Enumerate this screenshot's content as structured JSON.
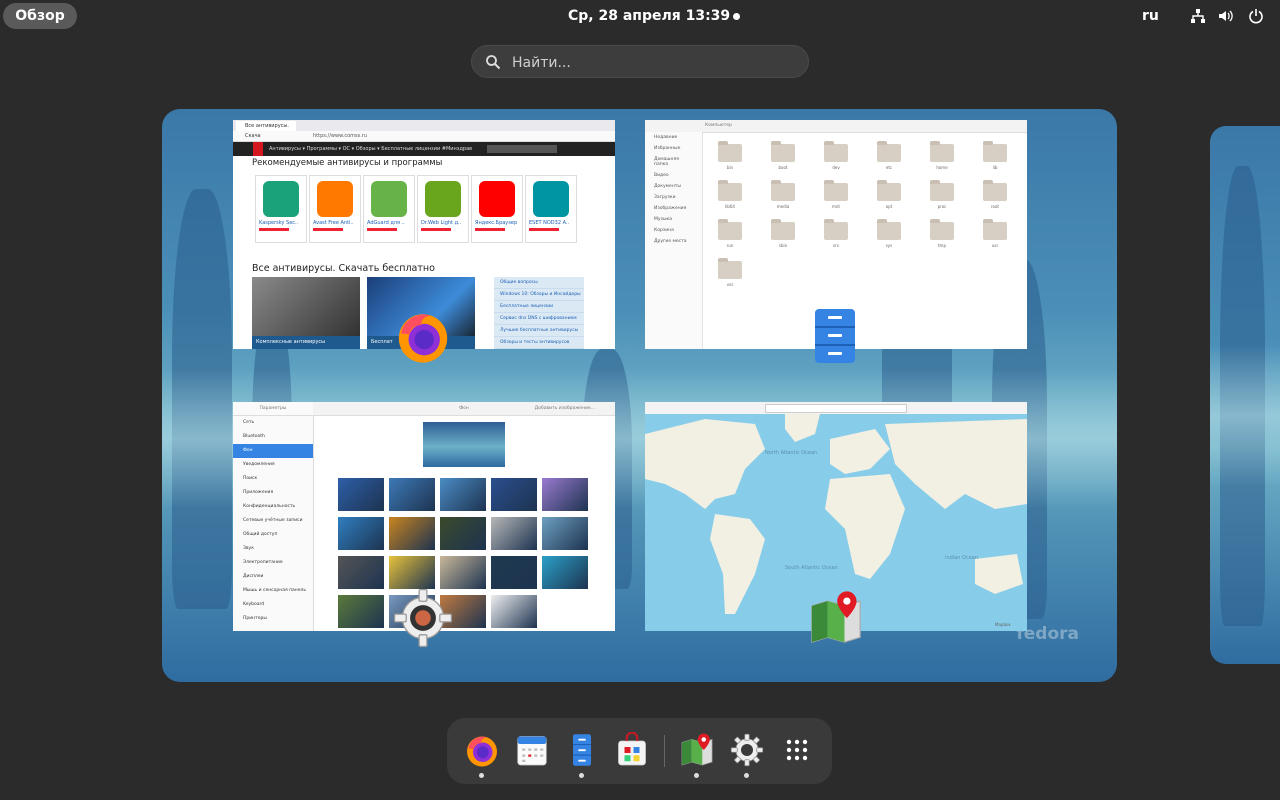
{
  "topbar": {
    "overview_label": "Обзор",
    "clock": "Ср, 28 апреля  13:39",
    "keyboard_layout": "ru",
    "icons": [
      "network-icon",
      "volume-icon",
      "power-icon"
    ]
  },
  "search": {
    "placeholder": "Найти..."
  },
  "windows": {
    "browser": {
      "tab_title": "Все антивирусы. Скача",
      "url": "https://www.comss.ru",
      "nav_menu": "Антивирусы ▾   Программы ▾   ОС ▾   Обзоры ▾   Бесплатные лицензии   #Минздрав",
      "heading_recommended": "Рекомендуемые антивирусы и программы",
      "apps": [
        {
          "name": "Kaspersky Sec..",
          "color": "#1aa37a"
        },
        {
          "name": "Avast Free Anti..",
          "color": "#ff7800"
        },
        {
          "name": "AdGuard для ..",
          "color": "#67b347"
        },
        {
          "name": "Dr.Web Light д..",
          "color": "#6aa61d"
        },
        {
          "name": "Яндекс.Браузер",
          "color": "#ff0000"
        },
        {
          "name": "ESET NOD32 A..",
          "color": "#0096a1"
        }
      ],
      "heading_all": "Все антивирусы. Скачать бесплатно",
      "caption_1": "Комплексные антивирусы",
      "caption_2": "Бесплат",
      "side_links": [
        "Общие вопросы",
        "Windows 10: Обзоры и Инсайдеры",
        "Бесплатные лицензии",
        "Сервис dns DNS с шифрованием",
        "Лучшие бесплатные антивирусы",
        "Обзоры и тесты антивирусов"
      ]
    },
    "files": {
      "location": "Компьютер",
      "sidebar": [
        "Недавние",
        "Избранные",
        "Домашняя папка",
        "Видео",
        "Документы",
        "Загрузки",
        "Изображения",
        "Музыка",
        "Корзина",
        "Другие места"
      ],
      "folders": [
        "bin",
        "boot",
        "dev",
        "etc",
        "home",
        "lib",
        "lib64",
        "media",
        "mnt",
        "opt",
        "proc",
        "root",
        "run",
        "sbin",
        "srv",
        "sys",
        "tmp",
        "usr",
        "var"
      ]
    },
    "settings": {
      "sidebar_title": "Параметры",
      "main_title": "Фон",
      "add_button": "Добавить изображение...",
      "items": [
        "Сеть",
        "Bluetooth",
        "Фон",
        "Уведомления",
        "Поиск",
        "Приложения",
        "Конфиденциальность",
        "Сетевые учётные записи",
        "Общий доступ",
        "Звук",
        "Электропитание",
        "Дисплеи",
        "Мышь и сенсорная панель",
        "Keyboard",
        "Принтеры"
      ],
      "selected_index": 2
    },
    "maps": {
      "labels": [
        "North Atlantic Ocean",
        "South Atlantic Ocean",
        "Indian Ocean"
      ],
      "attribution": "Mapbox"
    }
  },
  "workspace": {
    "watermark": "fedora"
  },
  "dash": {
    "apps": [
      "firefox",
      "calendar",
      "files",
      "software",
      "maps",
      "settings",
      "show-apps"
    ]
  }
}
